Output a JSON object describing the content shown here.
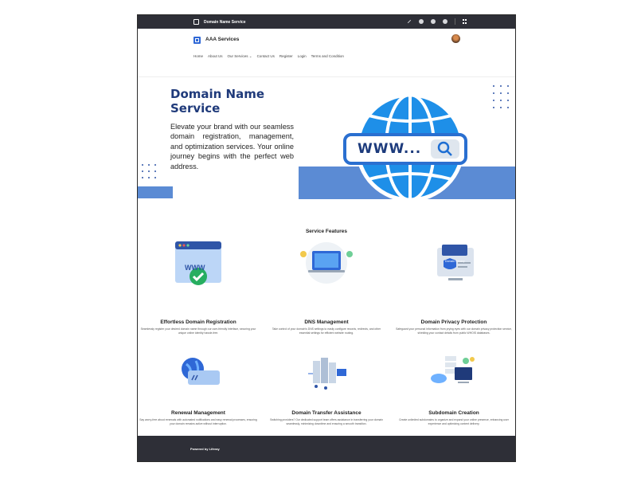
{
  "topbar": {
    "title": "Domain Name Service"
  },
  "header": {
    "brand": "AAA Services",
    "nav": [
      "Home",
      "About Us",
      "Our Services ⌄",
      "Contact Us",
      "Register",
      "Login",
      "Terms and Condition"
    ]
  },
  "hero": {
    "title": "Domain Name Service",
    "text": "Elevate your brand with our seamless domain registration, management, and optimization services. Your online journey begins with the perfect web address.",
    "image_label": "WWW..."
  },
  "features": {
    "title": "Service Features",
    "items": [
      {
        "name": "Effortless Domain Registration",
        "desc": "Seamlessly register your desired domain name through our user-friendly interface, securing your unique online identity hassle-free."
      },
      {
        "name": "DNS Management",
        "desc": "Take control of your domain's DNS settings to easily configure records, redirects, and other essential settings for efficient website routing."
      },
      {
        "name": "Domain Privacy Protection",
        "desc": "Safeguard your personal information from prying eyes with our domain privacy protection service, shielding your contact details from public WHOIS databases."
      },
      {
        "name": "Renewal Management",
        "desc": "Say worry-free about renewals with automated notifications and easy renewal processes, ensuring your domain remains active without interruption."
      },
      {
        "name": "Domain Transfer Assistance",
        "desc": "Switching providers? Our dedicated support team offers assistance in transferring your domain seamlessly, minimizing downtime and ensuring a smooth transition."
      },
      {
        "name": "Subdomain Creation",
        "desc": "Create unlimited subdomains to organize and expand your online presence, enhancing user experience and optimizing content delivery."
      }
    ],
    "www_badge": "WWW",
    "privacy_label": "Domain Privacy"
  },
  "footer": {
    "text": "Powered by Liferay"
  },
  "colors": {
    "brand_blue": "#2f68d6",
    "hero_band": "#5b8bd4",
    "title_navy": "#1f3a7a",
    "dark_bar": "#2e2f37"
  }
}
